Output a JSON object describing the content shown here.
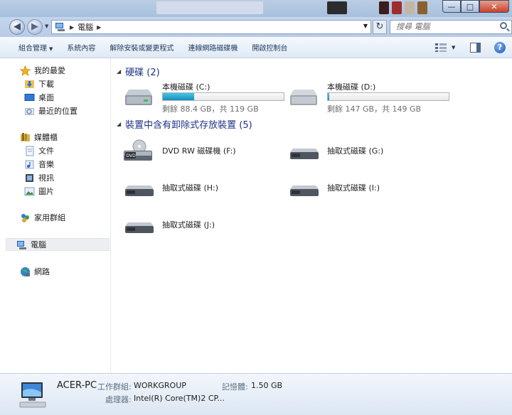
{
  "window": {
    "controls": {
      "minimize": "—",
      "maximize": "□",
      "close": "✕"
    }
  },
  "address": {
    "back_icon": "back-arrow-icon",
    "forward_icon": "forward-arrow-icon",
    "crumb": "電腦",
    "refresh_glyph": "↻",
    "search_placeholder": "搜尋 電腦"
  },
  "toolbar": {
    "organize": "組合管理",
    "properties": "系統內容",
    "uninstall": "解除安裝或變更程式",
    "map_drive": "連線網路磁碟機",
    "control_panel": "開啟控制台",
    "help": "?"
  },
  "nav": {
    "favorites": "我的最愛",
    "downloads": "下載",
    "desktop": "桌面",
    "recent": "最近的位置",
    "libraries": "媒體櫃",
    "documents": "文件",
    "music": "音樂",
    "videos": "視訊",
    "pictures": "圖片",
    "homegroup": "家用群組",
    "computer": "電腦",
    "network": "網路"
  },
  "groups": {
    "hdd": "硬碟 (2)",
    "removable": "裝置中含有卸除式存放裝置 (5)"
  },
  "drives": {
    "c": {
      "name": "本機磁碟 (C:)",
      "free": "剩餘 88.4 GB，共 119 GB",
      "used_fraction": 0.257
    },
    "d": {
      "name": "本機磁碟 (D:)",
      "free": "剩餘 147 GB，共 149 GB",
      "used_fraction": 0.013
    },
    "f": {
      "name": "DVD RW 磁碟機 (F:)",
      "dvd_label": "DVD"
    },
    "g": {
      "name": "抽取式磁碟 (G:)"
    },
    "h": {
      "name": "抽取式磁碟 (H:)"
    },
    "i": {
      "name": "抽取式磁碟 (I:)"
    },
    "j": {
      "name": "抽取式磁碟 (J:)"
    }
  },
  "details": {
    "pc_name": "ACER-PC",
    "workgroup_label": "工作群組:",
    "workgroup": "WORKGROUP",
    "memory_label": "記憶體:",
    "memory": "1.50 GB",
    "cpu_label": "處理器:",
    "cpu": "Intel(R) Core(TM)2 CP..."
  },
  "colors": {
    "accent": "#1e3287",
    "bar_fill": "#26a0da",
    "glass": "#b9cde4"
  }
}
